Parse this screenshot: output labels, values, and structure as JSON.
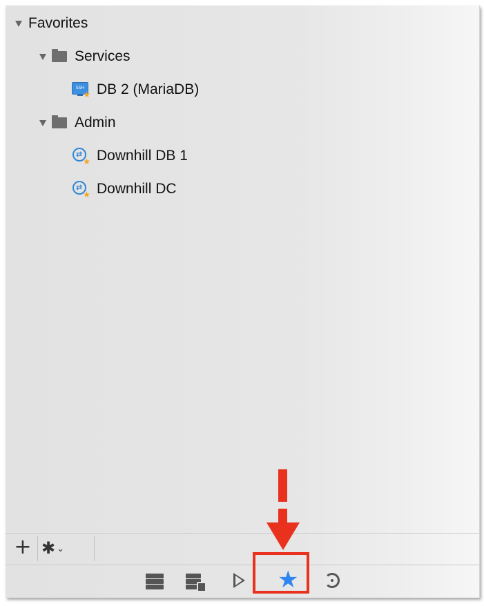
{
  "tree": {
    "root": {
      "label": "Favorites",
      "expanded": true
    },
    "groups": [
      {
        "label": "Services",
        "expanded": true,
        "items": [
          {
            "label": "DB 2 (MariaDB)",
            "icon": "ssh-favorite-icon",
            "icon_text": "SSH"
          }
        ]
      },
      {
        "label": "Admin",
        "expanded": true,
        "items": [
          {
            "label": "Downhill DB 1",
            "icon": "rdp-favorite-icon"
          },
          {
            "label": "Downhill DC",
            "icon": "rdp-favorite-icon"
          }
        ]
      }
    ]
  },
  "bottom_bar": {
    "add_label": "+",
    "actions_label": "✱",
    "actions_chevron": "⌄"
  },
  "toolbar": {
    "buttons": [
      "open-icon",
      "open-external-icon",
      "play-icon",
      "favorite-star-icon",
      "recent-icon"
    ],
    "favorite_symbol": "★",
    "favorite_active": true
  },
  "colors": {
    "accent_blue": "#2f86f0",
    "annotation_red": "#e8321d",
    "favorite_badge": "#f4a522"
  }
}
